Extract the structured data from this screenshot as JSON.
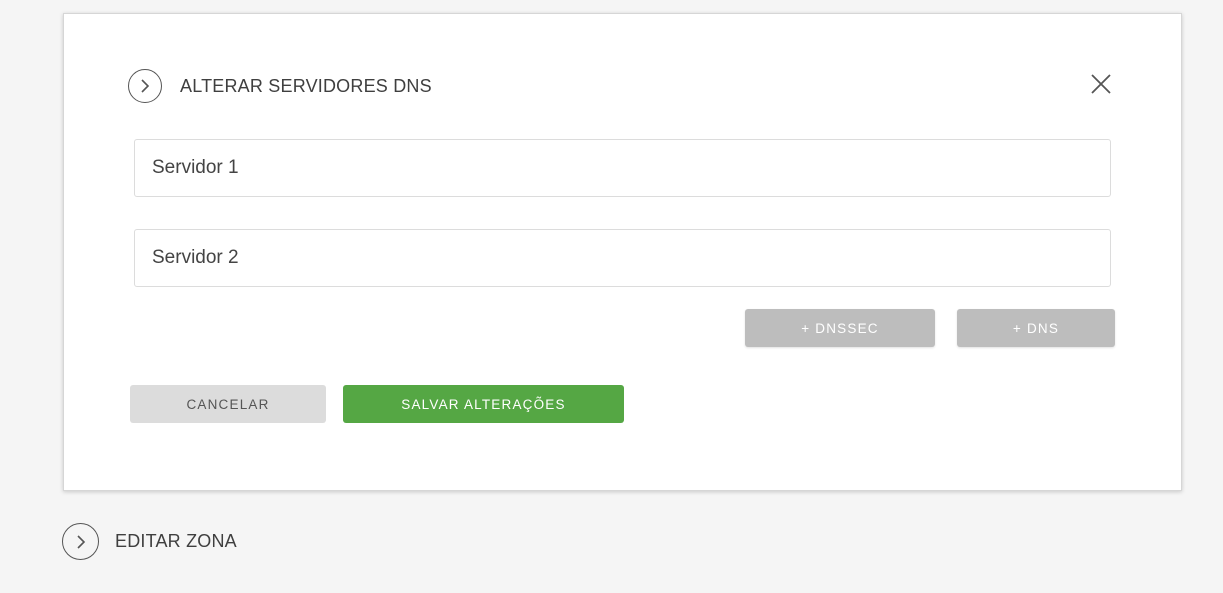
{
  "modal": {
    "title": "ALTERAR SERVIDORES DNS",
    "fields": [
      {
        "placeholder": "Servidor 1",
        "value": ""
      },
      {
        "placeholder": "Servidor 2",
        "value": ""
      }
    ],
    "add_dnssec_label": "+ DNSSEC",
    "add_dns_label": "+ DNS",
    "cancel_label": "CANCELAR",
    "save_label": "SALVAR ALTERAÇÕES"
  },
  "sections": [
    {
      "label": "EDITAR ZONA"
    }
  ],
  "icons": {
    "expand": "chevron-right-icon",
    "close": "close-icon"
  },
  "colors": {
    "primary": "#55a744",
    "secondary_button": "#bdbdbd",
    "cancel_button": "#dcdcdc",
    "background": "#f5f5f5"
  }
}
